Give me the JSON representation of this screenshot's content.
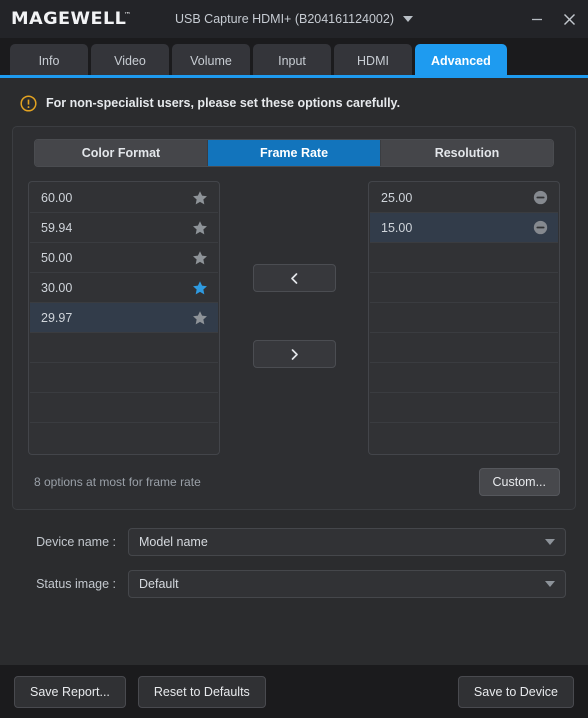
{
  "titlebar": {
    "logo_text": "MAGEWELL",
    "logo_tm": "™",
    "device_name": "USB Capture HDMI+ (B204161124002)",
    "dropdown_icon": "caret-down-icon",
    "minimize_icon": "minimize-icon",
    "close_icon": "close-icon"
  },
  "tabs": [
    {
      "label": "Info",
      "active": false
    },
    {
      "label": "Video",
      "active": false
    },
    {
      "label": "Volume",
      "active": false
    },
    {
      "label": "Input",
      "active": false
    },
    {
      "label": "HDMI",
      "active": false
    },
    {
      "label": "Advanced",
      "active": true
    }
  ],
  "notice": {
    "icon": "warning-circle-icon",
    "icon_color": "#e3a321",
    "text": "For non-specialist users, please set these options carefully."
  },
  "segmented": [
    {
      "label": "Color Format",
      "active": false
    },
    {
      "label": "Frame Rate",
      "active": true
    },
    {
      "label": "Resolution",
      "active": false
    }
  ],
  "available_list": {
    "name": "available-frame-rates",
    "row_count": 9,
    "items": [
      {
        "value": "60.00",
        "starred": false,
        "selected": false
      },
      {
        "value": "59.94",
        "starred": false,
        "selected": false
      },
      {
        "value": "50.00",
        "starred": false,
        "selected": false
      },
      {
        "value": "30.00",
        "starred": true,
        "selected": false
      },
      {
        "value": "29.97",
        "starred": false,
        "selected": true
      }
    ]
  },
  "selected_list": {
    "name": "selected-frame-rates",
    "row_count": 9,
    "items": [
      {
        "value": "25.00",
        "selected": false
      },
      {
        "value": "15.00",
        "selected": true
      }
    ]
  },
  "transfer": {
    "move_left_icon": "chevron-left-icon",
    "move_right_icon": "chevron-right-icon"
  },
  "panel_footer": {
    "hint": "8 options at most for frame rate",
    "custom_button": "Custom..."
  },
  "fields": [
    {
      "label": "Device name :",
      "value": "Model name",
      "name": "device-name-select"
    },
    {
      "label": "Status image :",
      "value": "Default",
      "name": "status-image-select"
    }
  ],
  "footer": {
    "save_report": "Save Report...",
    "reset_defaults": "Reset to Defaults",
    "save_to_device": "Save to Device"
  },
  "colors": {
    "accent_blue": "#1e9bf0",
    "segment_blue": "#1274bc",
    "star_active": "#2e9ae0",
    "star_inactive": "#8e9398",
    "warning": "#e3a321"
  }
}
